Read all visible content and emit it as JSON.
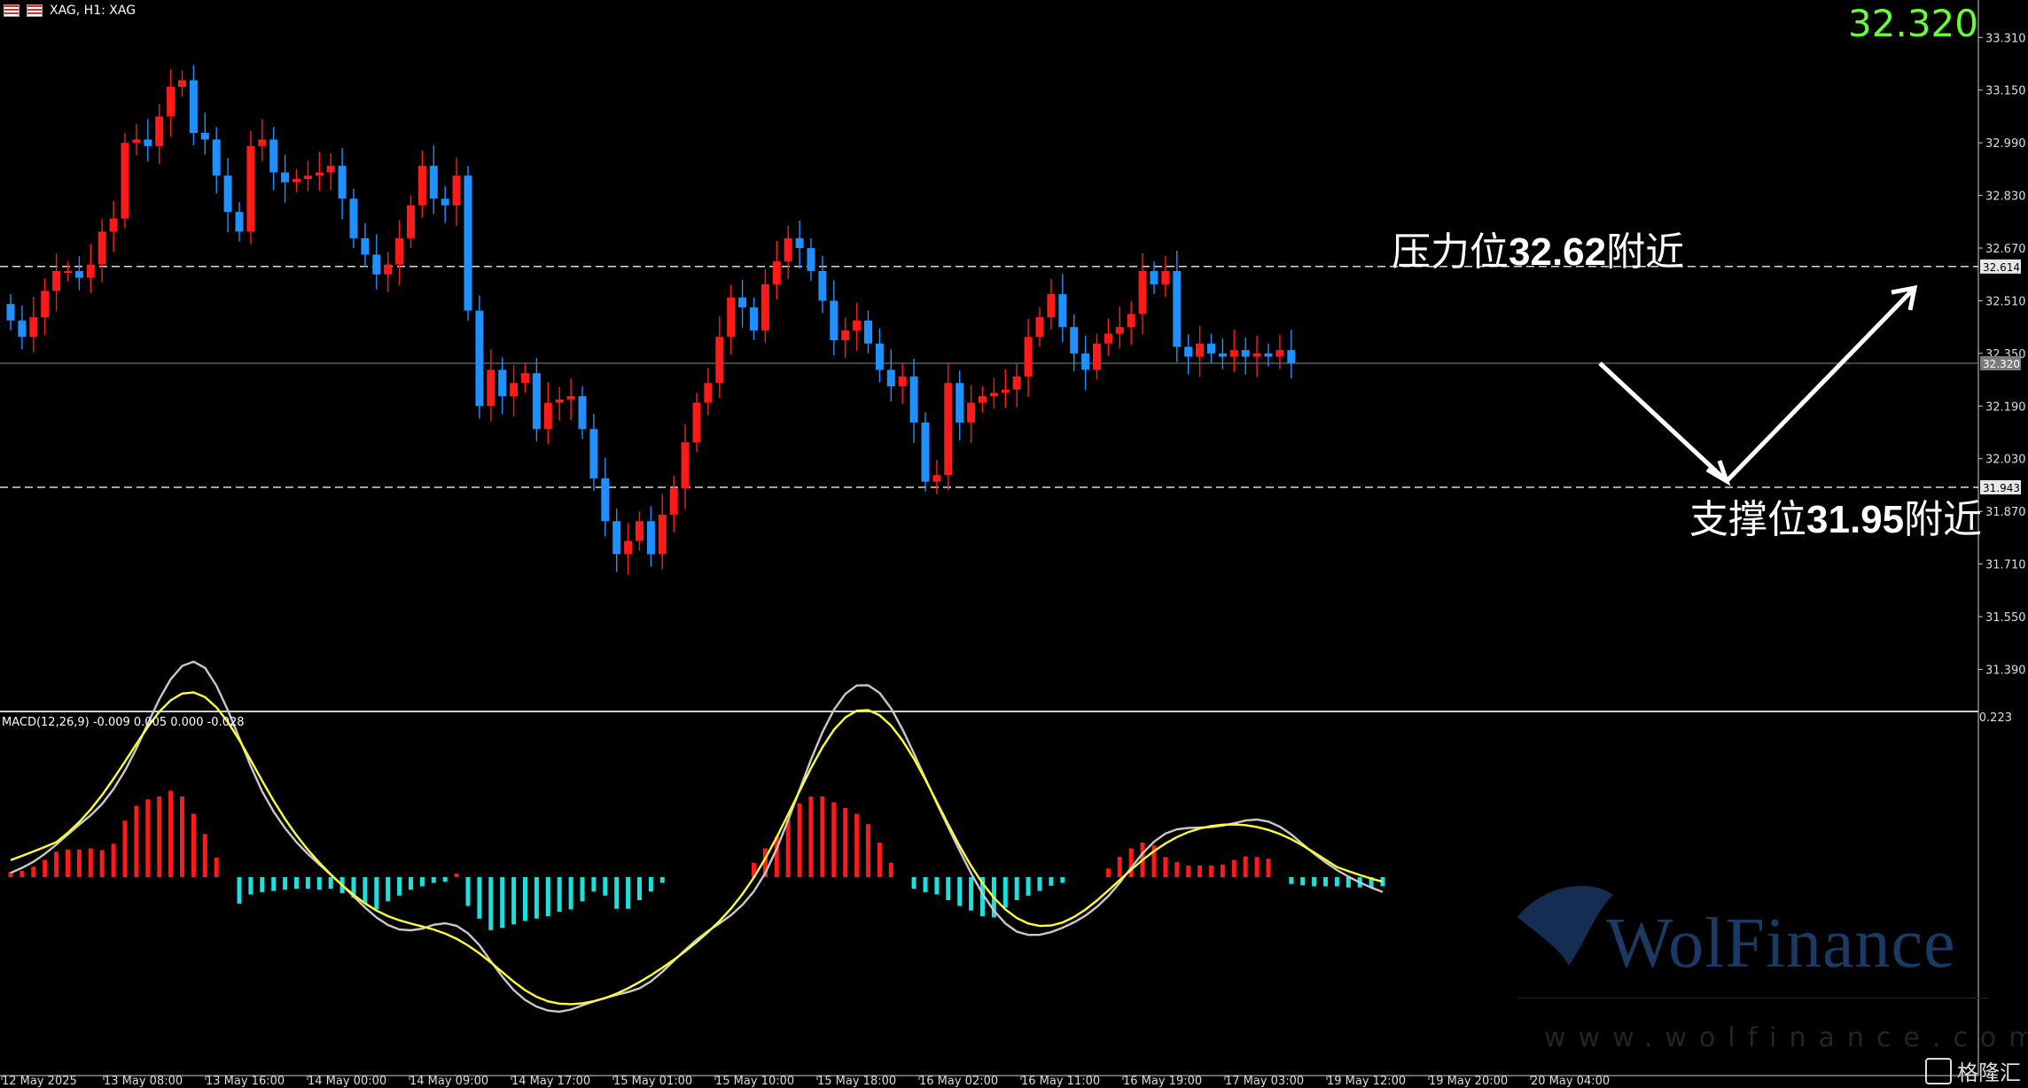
{
  "header": {
    "title": "XAG, H1:  XAG"
  },
  "last_price": "32.320",
  "annotations": {
    "resistance": {
      "prefix": "压力位",
      "value": "32.62",
      "suffix": "附近"
    },
    "support": {
      "prefix": "支撑位",
      "value": "31.95",
      "suffix": "附近"
    }
  },
  "macd_label": "MACD(12,26,9) -0.009 0.005 0.000 -0.028",
  "macd_axis_top": "0.223",
  "watermark": {
    "brand": "WolFinance",
    "url": "www.wolfinance.com"
  },
  "brand_badge": "格隆汇",
  "colors": {
    "up": "#ff1a1a",
    "down": "#1e90ff",
    "hist_pos": "#ff1a1a",
    "hist_neg": "#1ae0e0",
    "macd_line": "#c8c8c8",
    "signal_line": "#ffff33",
    "price_text": "#66ff33"
  },
  "chart_data": {
    "type": "candlestick",
    "symbol": "XAG",
    "timeframe": "H1",
    "price_ticks": [
      "33.310",
      "33.150",
      "32.990",
      "32.830",
      "32.670",
      "32.510",
      "32.350",
      "32.190",
      "32.030",
      "31.870",
      "31.710",
      "31.550",
      "31.390"
    ],
    "price_markers": [
      {
        "label": "32.614",
        "value": 32.614
      },
      {
        "label": "32.320",
        "value": 32.32
      },
      {
        "label": "31.943",
        "value": 31.943
      }
    ],
    "ylim": [
      31.27,
      33.37
    ],
    "levels": {
      "resistance": 32.614,
      "support": 31.943,
      "current": 32.32
    },
    "time_labels": [
      "12 May 2025",
      "13 May 08:00",
      "13 May 16:00",
      "14 May 00:00",
      "14 May 09:00",
      "14 May 17:00",
      "15 May 01:00",
      "15 May 10:00",
      "15 May 18:00",
      "16 May 02:00",
      "16 May 11:00",
      "16 May 19:00",
      "17 May 03:00",
      "19 May 12:00",
      "19 May 20:00",
      "20 May 04:00"
    ],
    "closes": [
      32.45,
      32.4,
      32.46,
      32.54,
      32.6,
      32.6,
      32.58,
      32.62,
      32.72,
      32.76,
      32.99,
      33.0,
      32.98,
      33.07,
      33.16,
      33.18,
      33.02,
      33.0,
      32.89,
      32.78,
      32.72,
      32.98,
      33.0,
      32.9,
      32.87,
      32.88,
      32.89,
      32.9,
      32.92,
      32.82,
      32.7,
      32.65,
      32.59,
      32.62,
      32.7,
      32.8,
      32.92,
      32.82,
      32.8,
      32.89,
      32.48,
      32.19,
      32.3,
      32.22,
      32.26,
      32.29,
      32.12,
      32.2,
      32.21,
      32.22,
      32.12,
      31.97,
      31.84,
      31.74,
      31.78,
      31.84,
      31.74,
      31.86,
      31.94,
      32.08,
      32.2,
      32.26,
      32.4,
      32.52,
      32.49,
      32.42,
      32.56,
      32.63,
      32.7,
      32.67,
      32.6,
      32.51,
      32.39,
      32.42,
      32.45,
      32.38,
      32.3,
      32.25,
      32.28,
      32.14,
      31.96,
      31.98,
      32.26,
      32.14,
      32.2,
      32.22,
      32.23,
      32.24,
      32.28,
      32.4,
      32.46,
      32.53,
      32.43,
      32.35,
      32.3,
      32.38,
      32.41,
      32.43,
      32.47,
      32.6,
      32.56,
      32.6,
      32.37,
      32.34,
      32.38,
      32.35,
      32.34,
      32.36,
      32.34,
      32.35,
      32.34,
      32.36,
      32.32
    ],
    "macd_hist": [
      0.009,
      0.011,
      0.018,
      0.03,
      0.044,
      0.048,
      0.048,
      0.05,
      0.047,
      0.058,
      0.098,
      0.124,
      0.135,
      0.14,
      0.15,
      0.14,
      0.11,
      0.075,
      0.034,
      0.0,
      -0.046,
      -0.03,
      -0.026,
      -0.024,
      -0.022,
      -0.02,
      -0.02,
      -0.022,
      -0.02,
      -0.028,
      -0.036,
      -0.046,
      -0.056,
      -0.042,
      -0.032,
      -0.022,
      -0.016,
      -0.01,
      -0.008,
      0.006,
      -0.05,
      -0.072,
      -0.092,
      -0.088,
      -0.082,
      -0.076,
      -0.072,
      -0.068,
      -0.06,
      -0.056,
      -0.042,
      -0.025,
      -0.032,
      -0.055,
      -0.055,
      -0.04,
      -0.025,
      -0.01,
      0.0,
      0.0,
      0.0,
      0.0,
      0.0,
      0.0,
      0.0,
      0.025,
      0.05,
      0.07,
      0.1,
      0.128,
      0.14,
      0.14,
      0.13,
      0.12,
      0.11,
      0.092,
      0.06,
      0.025,
      0.0,
      -0.02,
      -0.026,
      -0.03,
      -0.04,
      -0.05,
      -0.058,
      -0.068,
      -0.07,
      -0.053,
      -0.04,
      -0.032,
      -0.024,
      -0.015,
      -0.01,
      0.0,
      0.0,
      0.0,
      0.015,
      0.035,
      0.05,
      0.06,
      0.055,
      0.035,
      0.026,
      0.02,
      0.02,
      0.02,
      0.022,
      0.03,
      0.036,
      0.035,
      0.032,
      0.0,
      -0.012,
      -0.014,
      -0.016,
      -0.016,
      -0.016,
      -0.018,
      -0.018,
      -0.018,
      -0.016
    ]
  }
}
